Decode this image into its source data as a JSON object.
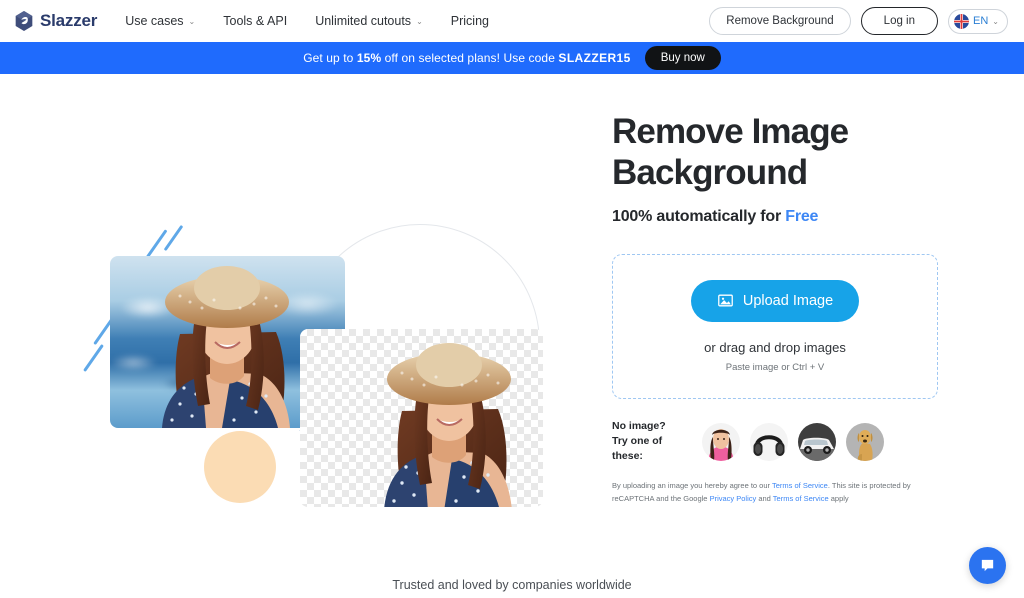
{
  "header": {
    "logo_text": "Slazzer",
    "logo_icon": "slazzer-diamond-icon",
    "nav": [
      {
        "label": "Use cases",
        "has_caret": true,
        "caret": "⌄"
      },
      {
        "label": "Tools & API",
        "has_caret": false,
        "caret": ""
      },
      {
        "label": "Unlimited cutouts",
        "has_caret": true,
        "caret": "⌄"
      },
      {
        "label": "Pricing",
        "has_caret": false,
        "caret": ""
      }
    ],
    "remove_background_label": "Remove Background",
    "login_label": "Log in",
    "language": {
      "code": "EN",
      "flag": "uk-flag-icon",
      "caret": "⌄"
    }
  },
  "banner": {
    "prefix": "Get up to ",
    "percent": "15%",
    "middle": " off on selected plans! Use code ",
    "code": "SLAZZER15",
    "cta_label": "Buy now",
    "bg_color": "#1f6bfd"
  },
  "hero": {
    "title_line1": "Remove Image",
    "title_line2": "Background",
    "subtitle_prefix": "100% automatically for ",
    "subtitle_accent": "Free",
    "accent_color": "#3d87f5"
  },
  "uploader": {
    "button_label": "Upload Image",
    "button_icon": "picture-icon",
    "button_color": "#17a3e8",
    "drag_text": "or drag and drop images",
    "paste_text": "Paste image or Ctrl + V"
  },
  "samples": {
    "label_line1": "No image?",
    "label_line2": "Try one of these:",
    "items": [
      {
        "name": "sample-woman-pink",
        "alt": "woman in pink sweater"
      },
      {
        "name": "sample-headphones",
        "alt": "black headphones"
      },
      {
        "name": "sample-car",
        "alt": "white suv car"
      },
      {
        "name": "sample-dog",
        "alt": "golden retriever dog"
      }
    ]
  },
  "legal": {
    "part1": "By uploading an image you hereby agree to our ",
    "link1": "Terms of Service",
    "part2": ". This site is protected by reCAPTCHA and the Google ",
    "link2": "Privacy Policy",
    "part3": " and ",
    "link3": "Terms of Service",
    "part4": " apply"
  },
  "visual": {
    "before_alt": "smiling woman in straw hat at harbour",
    "after_alt": "smiling woman in straw hat on transparent background",
    "arrow_name": "curved-arrow-icon"
  },
  "footer": {
    "trusted_text": "Trusted and loved by companies worldwide"
  },
  "chat": {
    "icon": "chat-bubble-icon",
    "color": "#2b73f0"
  }
}
